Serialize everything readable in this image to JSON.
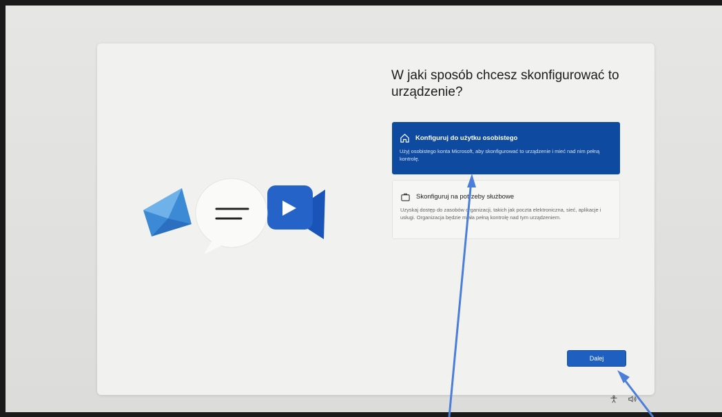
{
  "setup": {
    "title": "W jaki sposób chcesz skonfigurować to urządzenie?",
    "options": [
      {
        "title": "Konfiguruj do użytku osobistego",
        "description": "Użyj osobistego konta Microsoft, aby skonfigurować to urządzenie i mieć nad nim pełną kontrolę.",
        "selected": true,
        "icon": "home-icon"
      },
      {
        "title": "Skonfiguruj na potrzeby służbowe",
        "description": "Uzyskaj dostęp do zasobów organizacji, takich jak poczta elektroniczna, sieć, aplikacje i usługi. Organizacja będzie miała pełną kontrolę nad tym urządzeniem.",
        "selected": false,
        "icon": "briefcase-icon"
      }
    ],
    "next_label": "Dalej"
  },
  "colors": {
    "selected_bg": "#0e4ba0",
    "button_bg": "#1f5fbf",
    "annotation_arrow": "#4a7ed9"
  },
  "tray_icons": [
    "accessibility-icon",
    "volume-icon"
  ]
}
